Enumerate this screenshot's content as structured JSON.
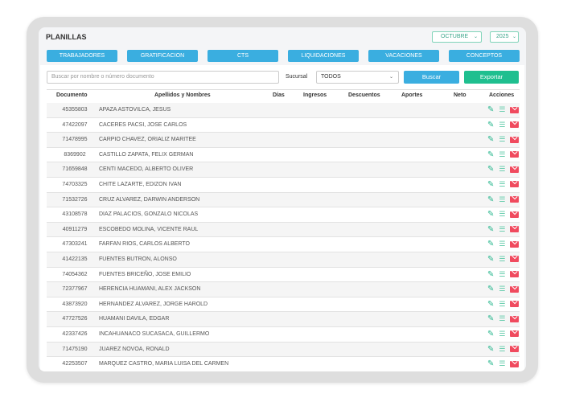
{
  "title": "PLANILLAS",
  "month": "OCTUBRE",
  "year": "2025",
  "nav": [
    "TRABAJADORES",
    "GRATIFICACION",
    "CTS",
    "LIQUIDACIONES",
    "VACACIONES",
    "CONCEPTOS"
  ],
  "search_placeholder": "Buscar por nombre o número documento",
  "sucursal_label": "Sucursal",
  "sucursal_value": "TODOS",
  "buscar": "Buscar",
  "exportar": "Exportar",
  "colors": {
    "primary": "#3aaee0",
    "success": "#1fbf8f",
    "danger": "#f04a5e"
  },
  "columns": [
    "Documento",
    "Apellidos y Nombres",
    "Días",
    "Ingresos",
    "Descuentos",
    "Aportes",
    "Neto",
    "Acciones"
  ],
  "rows": [
    [
      "45355803",
      "APAZA ASTOVILCA, JESUS"
    ],
    [
      "47422097",
      "CACERES PACSI, JOSE CARLOS"
    ],
    [
      "71478995",
      "CARPIO CHAVEZ, ORIALIZ MARITEE"
    ],
    [
      "8369902",
      "CASTILLO ZAPATA, FELIX GERMAN"
    ],
    [
      "71659848",
      "CENTI MACEDO, ALBERTO OLIVER"
    ],
    [
      "74703325",
      "CHITE LAZARTE, EDIZON IVAN"
    ],
    [
      "71532726",
      "CRUZ ALVAREZ, DARWIN ANDERSON"
    ],
    [
      "43108578",
      "DIAZ PALACIOS, GONZALO NICOLAS"
    ],
    [
      "40911279",
      "ESCOBEDO MOLINA, VICENTE RAUL"
    ],
    [
      "47303241",
      "FARFAN RIOS, CARLOS ALBERTO"
    ],
    [
      "41422135",
      "FUENTES BUTRON, ALONSO"
    ],
    [
      "74054362",
      "FUENTES BRICEÑO, JOSE EMILIO"
    ],
    [
      "72377967",
      "HERENCIA HUAMANI, ALEX JACKSON"
    ],
    [
      "43873920",
      "HERNANDEZ ALVAREZ, JORGE HAROLD"
    ],
    [
      "47727526",
      "HUAMANI DAVILA, EDGAR"
    ],
    [
      "42337426",
      "INCAHUANACO SUCASACA, GUILLERMO"
    ],
    [
      "71475190",
      "JUAREZ NOVOA, RONALD"
    ],
    [
      "42253507",
      "MARQUEZ CASTRO, MARIA LUISA DEL CARMEN"
    ]
  ]
}
